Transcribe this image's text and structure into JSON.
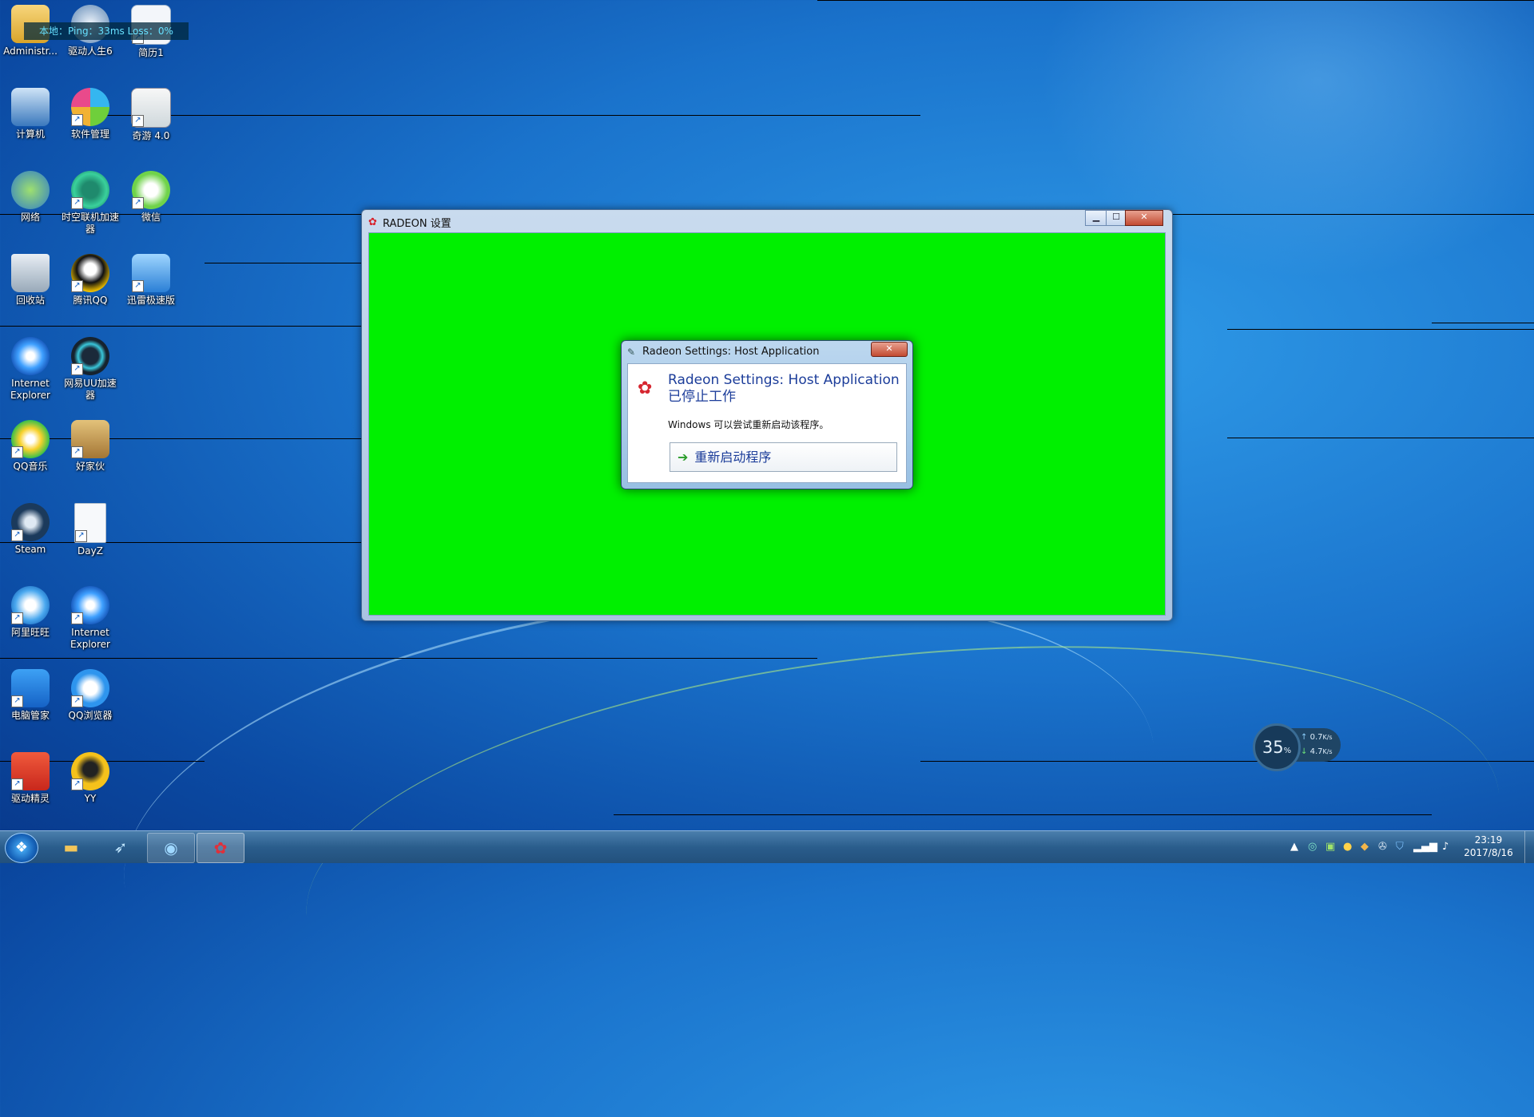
{
  "overlay": {
    "ping_text": "本地：Ping：33ms  Loss：0%"
  },
  "desktop_icons": [
    {
      "label": "Administr..."
    },
    {
      "label": "驱动人生6"
    },
    {
      "label": "简历1"
    },
    {
      "label": "计算机"
    },
    {
      "label": "软件管理"
    },
    {
      "label": "奇游 4.0"
    },
    {
      "label": "网络"
    },
    {
      "label": "时空联机加速器"
    },
    {
      "label": "微信"
    },
    {
      "label": "回收站"
    },
    {
      "label": "腾讯QQ"
    },
    {
      "label": "迅雷极速版"
    },
    {
      "label": "Internet Explorer"
    },
    {
      "label": "网易UU加速器"
    },
    {
      "label": "QQ音乐"
    },
    {
      "label": "好家伙"
    },
    {
      "label": "Steam"
    },
    {
      "label": "DayZ"
    },
    {
      "label": "阿里旺旺"
    },
    {
      "label": "Internet Explorer"
    },
    {
      "label": "电脑管家"
    },
    {
      "label": "QQ浏览器"
    },
    {
      "label": "驱动精灵"
    },
    {
      "label": "YY"
    }
  ],
  "main_window": {
    "title": "RADEON 设置"
  },
  "dialog": {
    "title": "Radeon Settings: Host Application",
    "heading": "Radeon Settings: Host Application 已停止工作",
    "message": "Windows 可以尝试重新启动该程序。",
    "restart_label": "重新启动程序",
    "close_glyph": "✕"
  },
  "speed_widget": {
    "cpu_percent": "35",
    "cpu_unit": "%",
    "upload": "0.7",
    "download": "4.7",
    "unit": "K/s"
  },
  "taskbar": {
    "time": "23:19",
    "date": "2017/8/16"
  },
  "colors": {
    "error_red": "#d62630",
    "dialog_blue": "#1c3d9a",
    "green_canvas": "#00f000"
  }
}
